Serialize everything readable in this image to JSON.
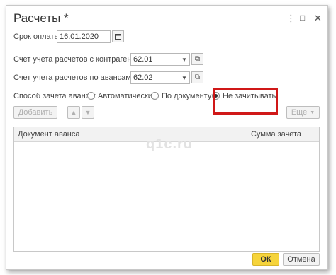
{
  "window": {
    "title": "Расчеты *",
    "menu_icon": "more-vertical-icon",
    "restore_icon": "square-icon",
    "close_icon": "close-icon"
  },
  "payment_due": {
    "label": "Срок оплаты:",
    "value": "16.01.2020"
  },
  "contractor_account": {
    "label": "Счет учета расчетов с контрагентом:",
    "value": "62.01"
  },
  "advance_account": {
    "label": "Счет учета расчетов по авансам:",
    "value": "62.02"
  },
  "advance_offset": {
    "label": "Способ зачета аванса:",
    "options": [
      {
        "label": "Автоматически",
        "selected": false
      },
      {
        "label": "По документу",
        "selected": false
      },
      {
        "label": "Не зачитывать",
        "selected": true
      }
    ]
  },
  "toolbar": {
    "add_label": "Добавить",
    "more_label": "Еще"
  },
  "table": {
    "columns": [
      "Документ аванса",
      "Сумма зачета"
    ],
    "rows": []
  },
  "watermark": "q1c.ru",
  "footer": {
    "ok_label": "ОК",
    "cancel_label": "Отмена"
  },
  "colors": {
    "ok_button": "#f6d43b",
    "highlight_border": "#d01818"
  }
}
